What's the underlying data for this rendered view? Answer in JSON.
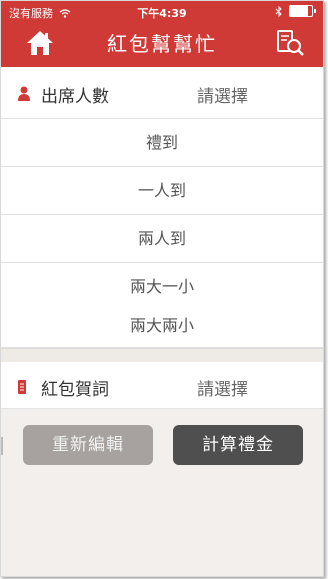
{
  "status_bar": {
    "carrier": "沒有服務",
    "time": "下午4:39",
    "battery_level": 0.8
  },
  "nav": {
    "title": "紅包幫幫忙",
    "home_icon": "home-icon",
    "search_icon": "document-search-icon"
  },
  "attendance": {
    "label": "出席人數",
    "value": "請選擇",
    "icon": "person-icon",
    "options": [
      "禮到",
      "一人到",
      "兩人到",
      "兩大一小",
      "兩大兩小"
    ]
  },
  "greeting": {
    "label": "紅包賀詞",
    "value": "請選擇",
    "icon": "red-envelope-icon"
  },
  "buttons": {
    "reset": "重新編輯",
    "calculate": "計算禮金"
  },
  "colors": {
    "brand_red": "#cf3a36",
    "reset_button": "#a7a29f",
    "calculate_button": "#4f4f4f",
    "bottom_background": "#f3efec"
  }
}
